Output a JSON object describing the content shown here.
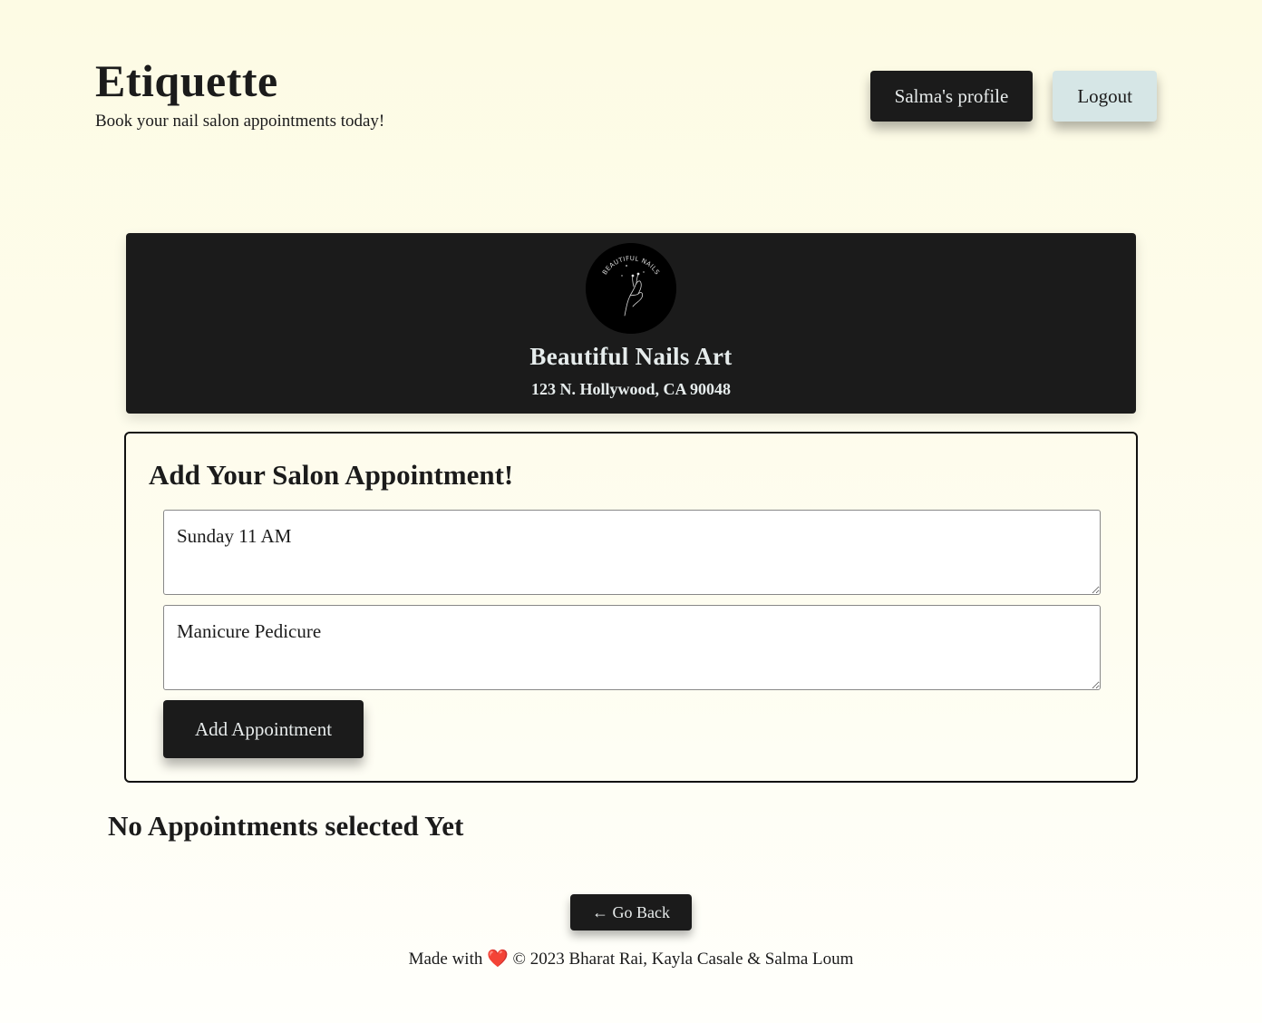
{
  "header": {
    "title": "Etiquette",
    "tagline": "Book your nail salon appointments today!"
  },
  "nav": {
    "profile_label": "Salma's profile",
    "logout_label": "Logout"
  },
  "salon": {
    "logo_text": "BEAUTIFUL NAILS",
    "name": "Beautiful Nails Art",
    "address": "123 N. Hollywood, CA 90048"
  },
  "appointment_form": {
    "title": "Add Your Salon Appointment!",
    "time_value": "Sunday 11 AM",
    "service_value": "Manicure Pedicure",
    "submit_label": "Add Appointment"
  },
  "appointments": {
    "empty_message": "No Appointments selected Yet"
  },
  "back_button_label": "← Go Back",
  "footer": {
    "made_with": "Made with",
    "heart_icon": "❤️",
    "credits": "© 2023 Bharat Rai, Kayla Casale & Salma Loum"
  },
  "colors": {
    "dark": "#1b1b1b",
    "logout_bg": "#d6e6e6",
    "page_bg": "#fdfbe4"
  }
}
